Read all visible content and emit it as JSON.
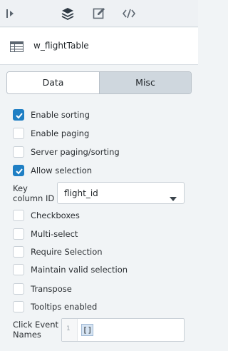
{
  "toolbar": {
    "icons": [
      "collapse-panel-icon",
      "layers-icon",
      "edit-icon",
      "code-icon"
    ]
  },
  "header": {
    "widget_icon": "table-icon",
    "widget_name": "w_flightTable"
  },
  "tabs": [
    {
      "label": "Data",
      "active": false
    },
    {
      "label": "Misc",
      "active": true
    }
  ],
  "options_top": [
    {
      "label": "Enable sorting",
      "checked": true
    },
    {
      "label": "Enable paging",
      "checked": false
    },
    {
      "label": "Server paging/sorting",
      "checked": false
    },
    {
      "label": "Allow selection",
      "checked": true
    }
  ],
  "key_column": {
    "label_line1": "Key",
    "label_line2": "column ID",
    "value": "flight_id"
  },
  "options_bottom": [
    {
      "label": "Checkboxes",
      "checked": false
    },
    {
      "label": "Multi-select",
      "checked": false
    },
    {
      "label": "Require Selection",
      "checked": false
    },
    {
      "label": "Maintain valid selection",
      "checked": false
    },
    {
      "label": "Transpose",
      "checked": false
    },
    {
      "label": "Tooltips enabled",
      "checked": false
    }
  ],
  "click_event": {
    "label_line1": "Click Event",
    "label_line2": "Names",
    "line_number": "1",
    "code": "[]"
  },
  "colors": {
    "accent": "#1f7fc4",
    "active_tab": "#cfd7de",
    "panel_bg": "#f1f4f6"
  }
}
